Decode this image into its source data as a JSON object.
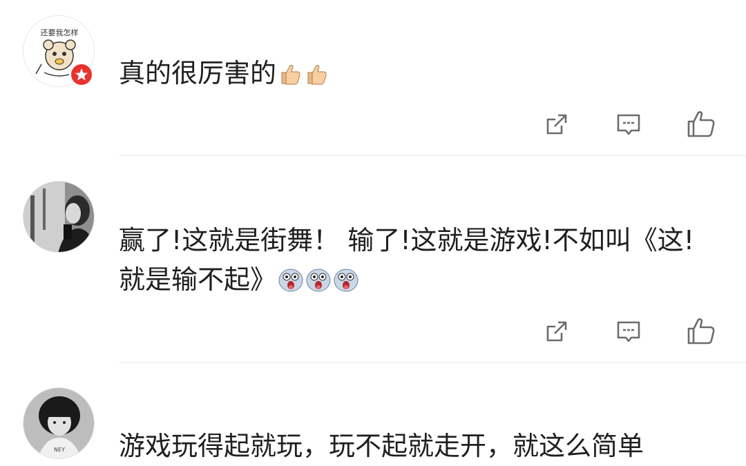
{
  "comments": [
    {
      "avatar": "cartoon-bear-avatar",
      "avatar_caption": "还要我怎样",
      "badge": "red-star-badge",
      "text": "真的很厉害的",
      "emojis": [
        "thumbs-up",
        "thumbs-up"
      ]
    },
    {
      "avatar": "bw-woman-photo-avatar",
      "line1": "赢了!这就是街舞！ 输了!这就是游戏!不如叫《这!",
      "line2": "就是输不起》",
      "emojis": [
        "surprised-face",
        "surprised-face",
        "surprised-face"
      ]
    },
    {
      "avatar": "bw-woman-bangs-avatar",
      "text": "游戏玩得起就玩，玩不起就走开，就这么简单"
    }
  ],
  "actions": [
    "share-icon",
    "reply-icon",
    "like-icon"
  ],
  "colors": {
    "icon": "#6b6b6b",
    "text": "#1f1f1f",
    "divider": "#e8e8e8",
    "badge": "#e8322d"
  }
}
